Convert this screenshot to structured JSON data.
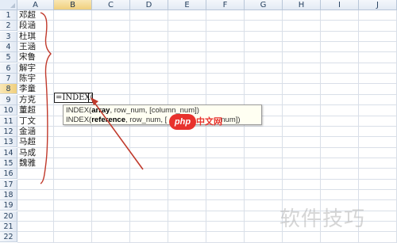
{
  "columns": [
    "A",
    "B",
    "C",
    "D",
    "E",
    "F",
    "G",
    "H",
    "I",
    "J"
  ],
  "selected_column": "B",
  "rows": [
    "1",
    "2",
    "3",
    "4",
    "5",
    "6",
    "7",
    "8",
    "9",
    "10",
    "11",
    "12",
    "13",
    "14",
    "15",
    "16",
    "17",
    "18",
    "19",
    "20",
    "21",
    "22"
  ],
  "selected_row": "8",
  "names": [
    "邓超",
    "段涵",
    "杜琪",
    "王涵",
    "宋鲁",
    "解宇",
    "陈宇",
    "李童",
    "方克",
    "董超",
    "丁文",
    "金涵",
    "马超",
    "马成",
    "魏雅"
  ],
  "active_cell": {
    "formula": "=INDEX("
  },
  "tooltip": {
    "line1": {
      "fn": "INDEX(",
      "bold": "array",
      "rest": ", row_num, [column_num])"
    },
    "line2": {
      "fn": "INDEX(",
      "bold": "reference",
      "rest": ", row_num, [",
      "tail": "num])"
    }
  },
  "logo": {
    "badge": "php",
    "text": "中文网"
  },
  "watermark": "软件技巧",
  "colors": {
    "annotation": "#c0392b",
    "header_selected": "#f0cf7d",
    "grid": "#d9dfe8"
  }
}
